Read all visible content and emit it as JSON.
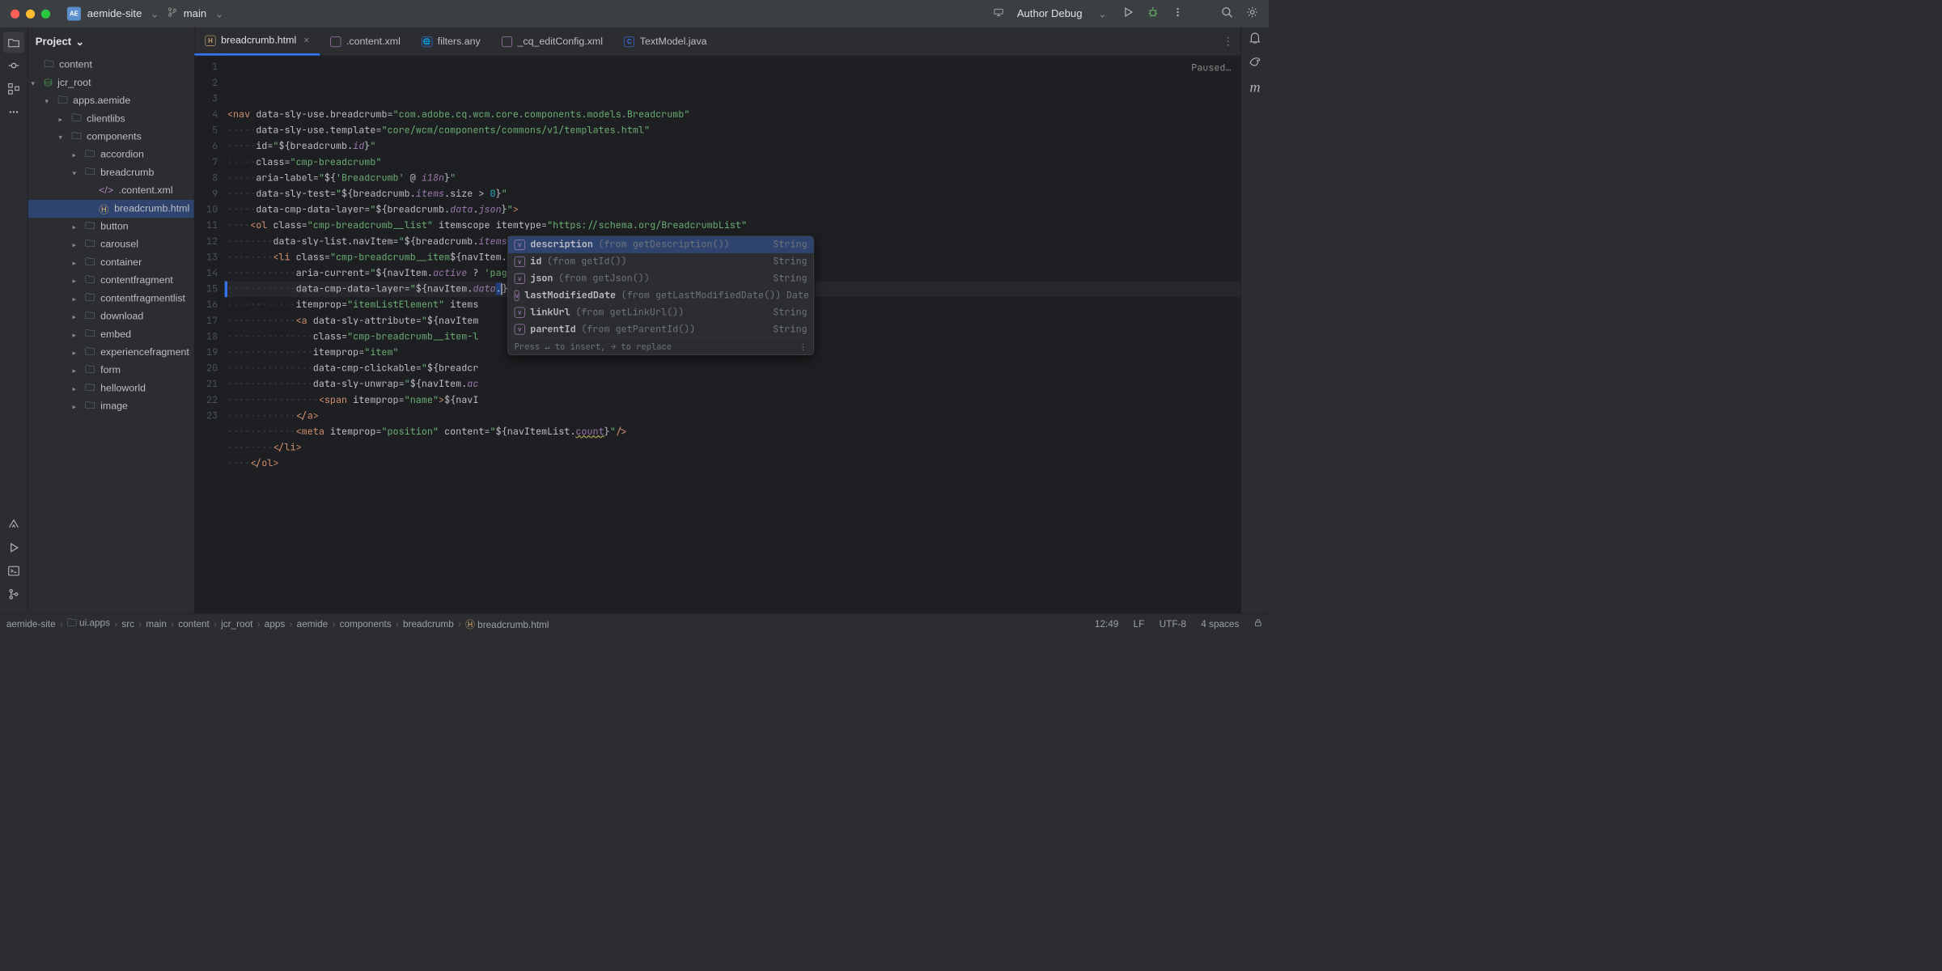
{
  "titlebar": {
    "project": "aemide-site",
    "branch": "main",
    "runConfig": "Author Debug"
  },
  "projectPanel": {
    "header": "Project",
    "tree": [
      {
        "depth": 0,
        "arrow": "",
        "icon": "folder",
        "label": "content"
      },
      {
        "depth": 0,
        "arrow": "▾",
        "icon": "db",
        "label": "jcr_root"
      },
      {
        "depth": 1,
        "arrow": "▾",
        "icon": "folder",
        "label": "apps.aemide"
      },
      {
        "depth": 2,
        "arrow": "▸",
        "icon": "folder",
        "label": "clientlibs"
      },
      {
        "depth": 2,
        "arrow": "▾",
        "icon": "folder",
        "label": "components"
      },
      {
        "depth": 3,
        "arrow": "▸",
        "icon": "folder",
        "label": "accordion"
      },
      {
        "depth": 3,
        "arrow": "▾",
        "icon": "folder",
        "label": "breadcrumb"
      },
      {
        "depth": 4,
        "arrow": "",
        "icon": "xml",
        "label": ".content.xml"
      },
      {
        "depth": 4,
        "arrow": "",
        "icon": "h",
        "label": "breadcrumb.html",
        "selected": true
      },
      {
        "depth": 3,
        "arrow": "▸",
        "icon": "folder",
        "label": "button"
      },
      {
        "depth": 3,
        "arrow": "▸",
        "icon": "folder",
        "label": "carousel"
      },
      {
        "depth": 3,
        "arrow": "▸",
        "icon": "folder",
        "label": "container"
      },
      {
        "depth": 3,
        "arrow": "▸",
        "icon": "folder",
        "label": "contentfragment"
      },
      {
        "depth": 3,
        "arrow": "▸",
        "icon": "folder",
        "label": "contentfragmentlist"
      },
      {
        "depth": 3,
        "arrow": "▸",
        "icon": "folder",
        "label": "download"
      },
      {
        "depth": 3,
        "arrow": "▸",
        "icon": "folder",
        "label": "embed"
      },
      {
        "depth": 3,
        "arrow": "▸",
        "icon": "folder",
        "label": "experiencefragment"
      },
      {
        "depth": 3,
        "arrow": "▸",
        "icon": "folder",
        "label": "form"
      },
      {
        "depth": 3,
        "arrow": "▸",
        "icon": "folder",
        "label": "helloworld"
      },
      {
        "depth": 3,
        "arrow": "▸",
        "icon": "folder",
        "label": "image"
      }
    ]
  },
  "tabs": [
    {
      "kind": "H",
      "color": "#c9a36a",
      "label": "breadcrumb.html",
      "active": true,
      "closable": true
    },
    {
      "kind": "</>",
      "color": "#b389c5",
      "label": ".content.xml"
    },
    {
      "kind": "🌐",
      "color": "#3574f0",
      "label": "filters.any"
    },
    {
      "kind": "</>",
      "color": "#b389c5",
      "label": "_cq_editConfig.xml"
    },
    {
      "kind": "C",
      "color": "#3574f0",
      "label": "TextModel.java"
    }
  ],
  "editor": {
    "paused": "Paused…",
    "lines": 23
  },
  "completion": {
    "items": [
      {
        "name": "description",
        "src": "(from getDescription())",
        "ret": "String",
        "sel": true
      },
      {
        "name": "id",
        "src": "(from getId())",
        "ret": "String"
      },
      {
        "name": "json",
        "src": "(from getJson())",
        "ret": "String"
      },
      {
        "name": "lastModifiedDate",
        "src": "(from getLastModifiedDate())",
        "ret": "Date"
      },
      {
        "name": "linkUrl",
        "src": "(from getLinkUrl())",
        "ret": "String"
      },
      {
        "name": "parentId",
        "src": "(from getParentId())",
        "ret": "String"
      }
    ],
    "hint": "Press ↵ to insert, → to replace"
  },
  "breadcrumbs": [
    "aemide-site",
    "ui.apps",
    "src",
    "main",
    "content",
    "jcr_root",
    "apps",
    "aemide",
    "components",
    "breadcrumb",
    "breadcrumb.html"
  ],
  "status": {
    "pos": "12:49",
    "sep": "LF",
    "enc": "UTF-8",
    "indent": "4 spaces"
  }
}
